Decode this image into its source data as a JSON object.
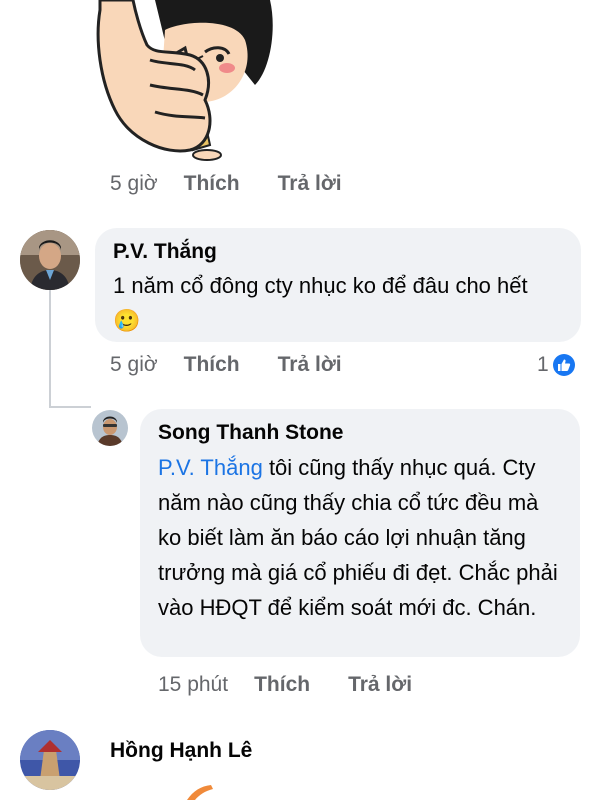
{
  "comment1": {
    "time": "5 giờ",
    "like_label": "Thích",
    "reply_label": "Trả lời"
  },
  "comment2": {
    "author": "P.V. Thắng",
    "text": "1 năm cổ đông cty nhục ko để đâu cho hết",
    "emoji": "🥲",
    "time": "5 giờ",
    "like_label": "Thích",
    "reply_label": "Trả lời",
    "reaction_count": "1",
    "reaction_icon": "like-icon"
  },
  "reply1": {
    "author": "Song Thanh Stone",
    "mention": "P.V. Thắng",
    "text": "tôi cũng thấy nhục quá. Cty năm nào cũng thấy chia cổ tức đều mà ko biết làm ăn báo cáo lợi nhuận tăng trưởng mà giá cổ phiếu đi đẹt. Chắc phải vào HĐQT để kiểm soát mới đc. Chán.",
    "time": "15 phút",
    "like_label": "Thích",
    "reply_label": "Trả lời"
  },
  "comment3": {
    "author": "Hồng Hạnh Lê"
  },
  "colors": {
    "bubble": "#f0f2f5",
    "meta_text": "#65676b",
    "mention": "#1b74e4",
    "like_blue": "#1877f2"
  }
}
